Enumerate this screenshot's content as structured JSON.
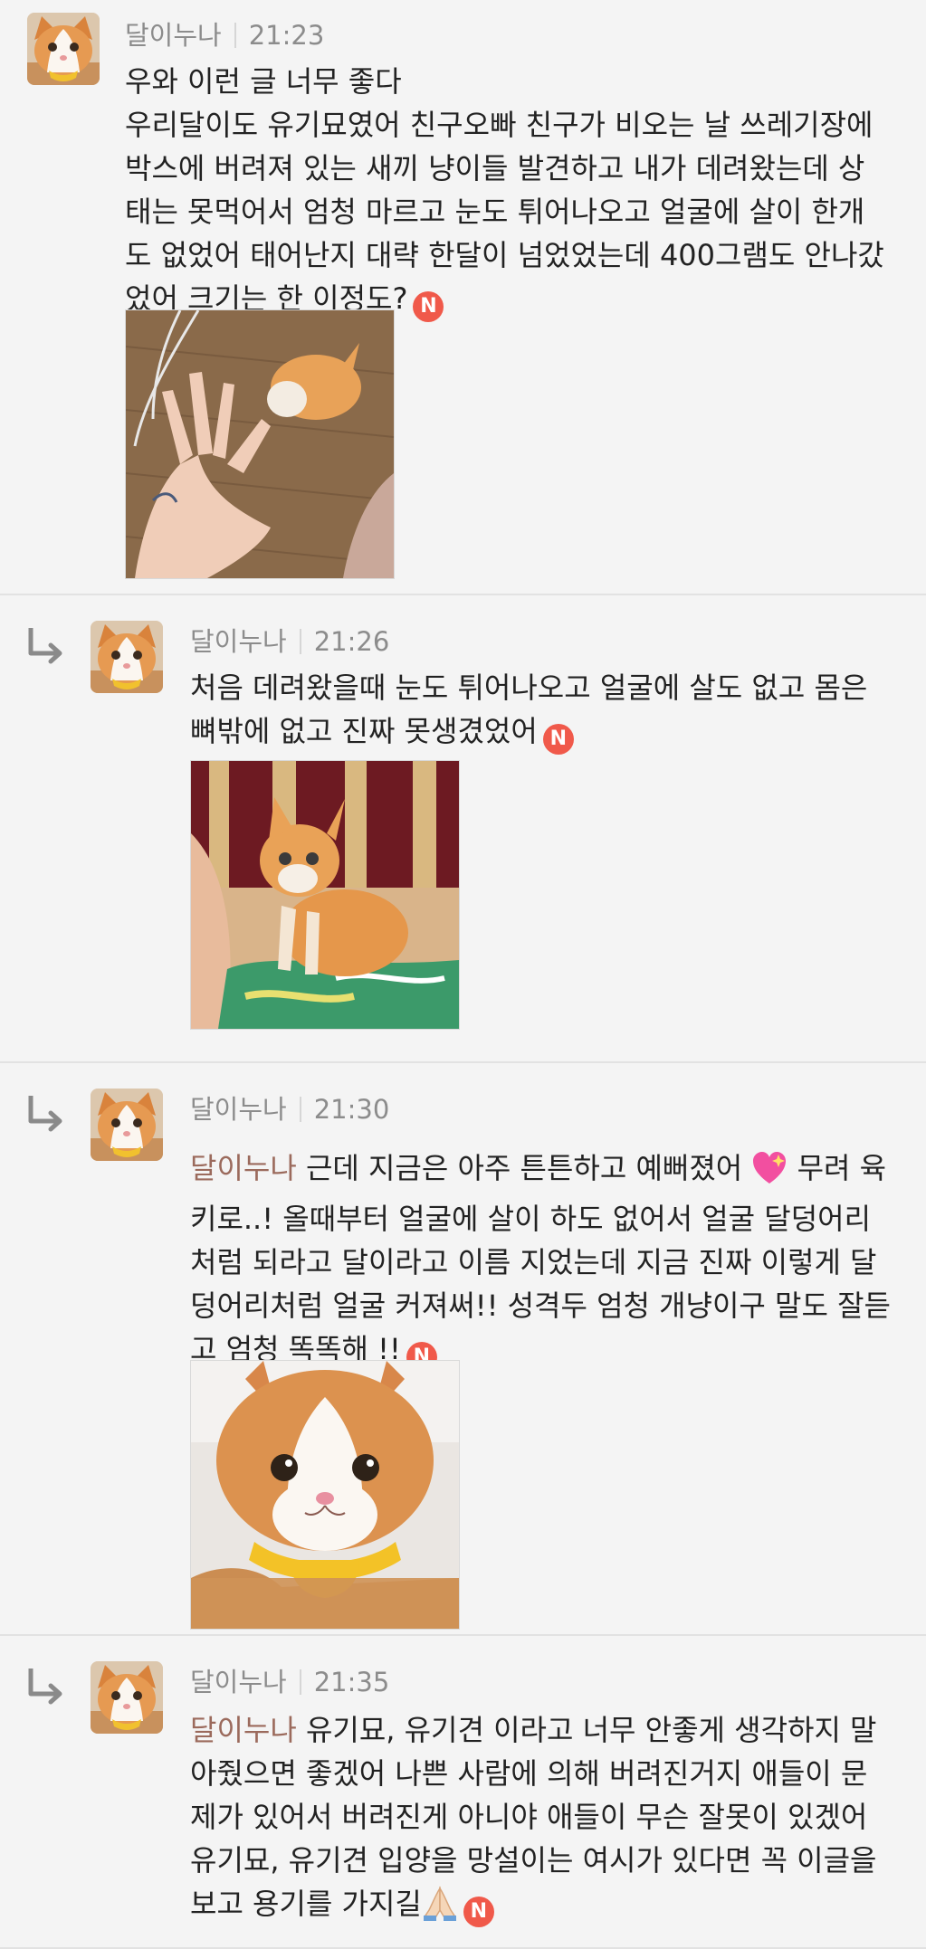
{
  "comments": [
    {
      "author": "달이누나",
      "time": "21:23",
      "lines": [
        "우와 이런 글 너무 좋다",
        "우리달이도 유기묘였어 친구오빠 친구가 비오는 날 쓰레기장에",
        "박스에 버려져 있는 새끼 냥이들 발견하고 내가 데려왔는데 상",
        "태는 못먹어서 엄청 마르고 눈도 튀어나오고 얼굴에 살이 한개",
        "도 없었어 태어난지 대략 한달이 넘었었는데 400그램도 안나갔",
        "었어 크기는 한 이정도?"
      ],
      "badge": "N",
      "photo": "kitten-on-wooden-floor-with-hand"
    },
    {
      "author": "달이누나",
      "time": "21:26",
      "lines": [
        "처음 데려왔을때 눈도 튀어나오고 얼굴에 살도 없고 몸은",
        "뼈밖에 없고 진짜 못생겼었어"
      ],
      "badge": "N",
      "photo": "thin-orange-kitten-on-cushion"
    },
    {
      "author": "달이누나",
      "time": "21:30",
      "mention": "달이누나",
      "lines": [
        " 근데 지금은 아주 튼튼하고 예뻐졌어",
        " 무려 육",
        "키로..! 올때부터 얼굴에 살이 하도 없어서 얼굴 달덩어리",
        "처럼 되라고 달이라고 이름 지었는데 지금 진짜 이렇게 달",
        "덩어리처럼 얼굴 커져써!! 성격두 엄청 개냥이구 말도 잘듣",
        "고 엄청 똑똑해 !!"
      ],
      "badge": "N",
      "photo": "grown-orange-cat-with-yellow-collar"
    },
    {
      "author": "달이누나",
      "time": "21:35",
      "mention": "달이누나",
      "lines": [
        " 유기묘, 유기견 이라고 너무 안좋게 생각하지 말",
        "아줬으면 좋겠어 나쁜 사람에 의해 버려진거지 애들이 문",
        "제가 있어서 버려진게 아니야 애들이 무슨 잘못이 있겠어",
        "유기묘, 유기견 입양을 망설이는 여시가 있다면 꼭 이글을",
        "보고 용기를 가지길"
      ],
      "badge": "N"
    }
  ],
  "icons": {
    "reply": "reply-arrow-icon",
    "new": "new-badge-icon",
    "heart": "sparkling-heart-icon",
    "pray": "folded-hands-icon"
  },
  "colors": {
    "badge": "#f0594a",
    "mention": "#9b6a5c",
    "meta": "#8c8c8c"
  }
}
